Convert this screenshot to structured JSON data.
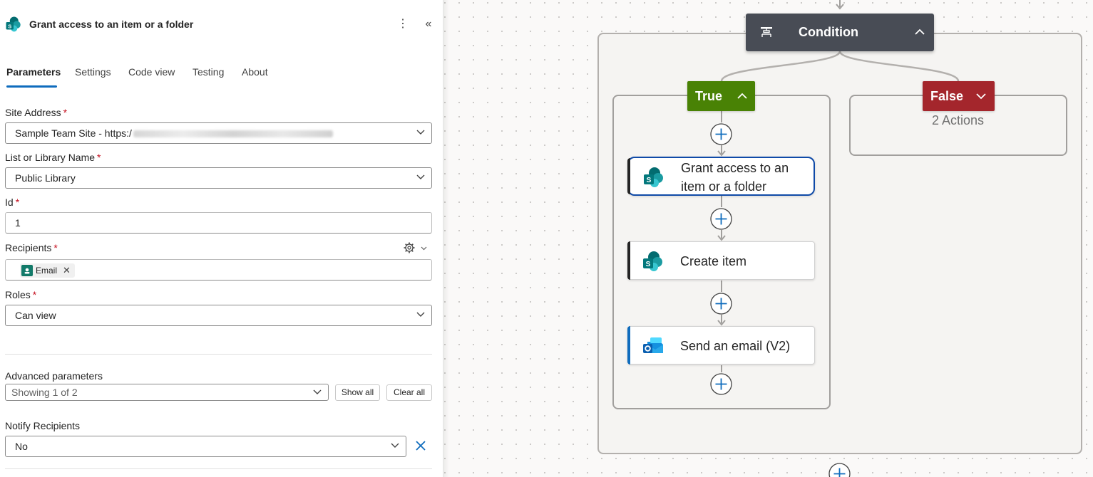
{
  "panel": {
    "title": "Grant access to an item or a folder",
    "tabs": [
      {
        "label": "Parameters",
        "active": true
      },
      {
        "label": "Settings"
      },
      {
        "label": "Code view"
      },
      {
        "label": "Testing"
      },
      {
        "label": "About"
      }
    ],
    "fields": {
      "site_address": {
        "label": "Site Address",
        "required": "*",
        "value": "Sample Team Site - https:/"
      },
      "list_name": {
        "label": "List or Library Name",
        "required": "*",
        "value": "Public Library"
      },
      "id": {
        "label": "Id",
        "required": "*",
        "value": "1"
      },
      "recipients": {
        "label": "Recipients",
        "required": "*",
        "token": "Email"
      },
      "roles": {
        "label": "Roles",
        "required": "*",
        "value": "Can view"
      }
    },
    "advanced": {
      "label": "Advanced parameters",
      "select_value": "Showing 1 of 2",
      "show_all": "Show all",
      "clear_all": "Clear all"
    },
    "notify": {
      "label": "Notify Recipients",
      "value": "No"
    }
  },
  "canvas": {
    "condition": {
      "title": "Condition"
    },
    "true_branch": {
      "label": "True",
      "color": "#498205",
      "actions": [
        {
          "title_line1": "Grant access to an",
          "title_line2": "item or a folder",
          "icon": "sharepoint-icon",
          "selected": true
        },
        {
          "title": "Create item",
          "icon": "sharepoint-icon"
        },
        {
          "title": "Send an email (V2)",
          "icon": "outlook-icon"
        }
      ]
    },
    "false_branch": {
      "label": "False",
      "color": "#a4262c",
      "summary": "2 Actions"
    },
    "colors": {
      "accent": "#0f6cbd",
      "condition_header": "#484c55",
      "selected_border": "#0f4aa8"
    }
  }
}
